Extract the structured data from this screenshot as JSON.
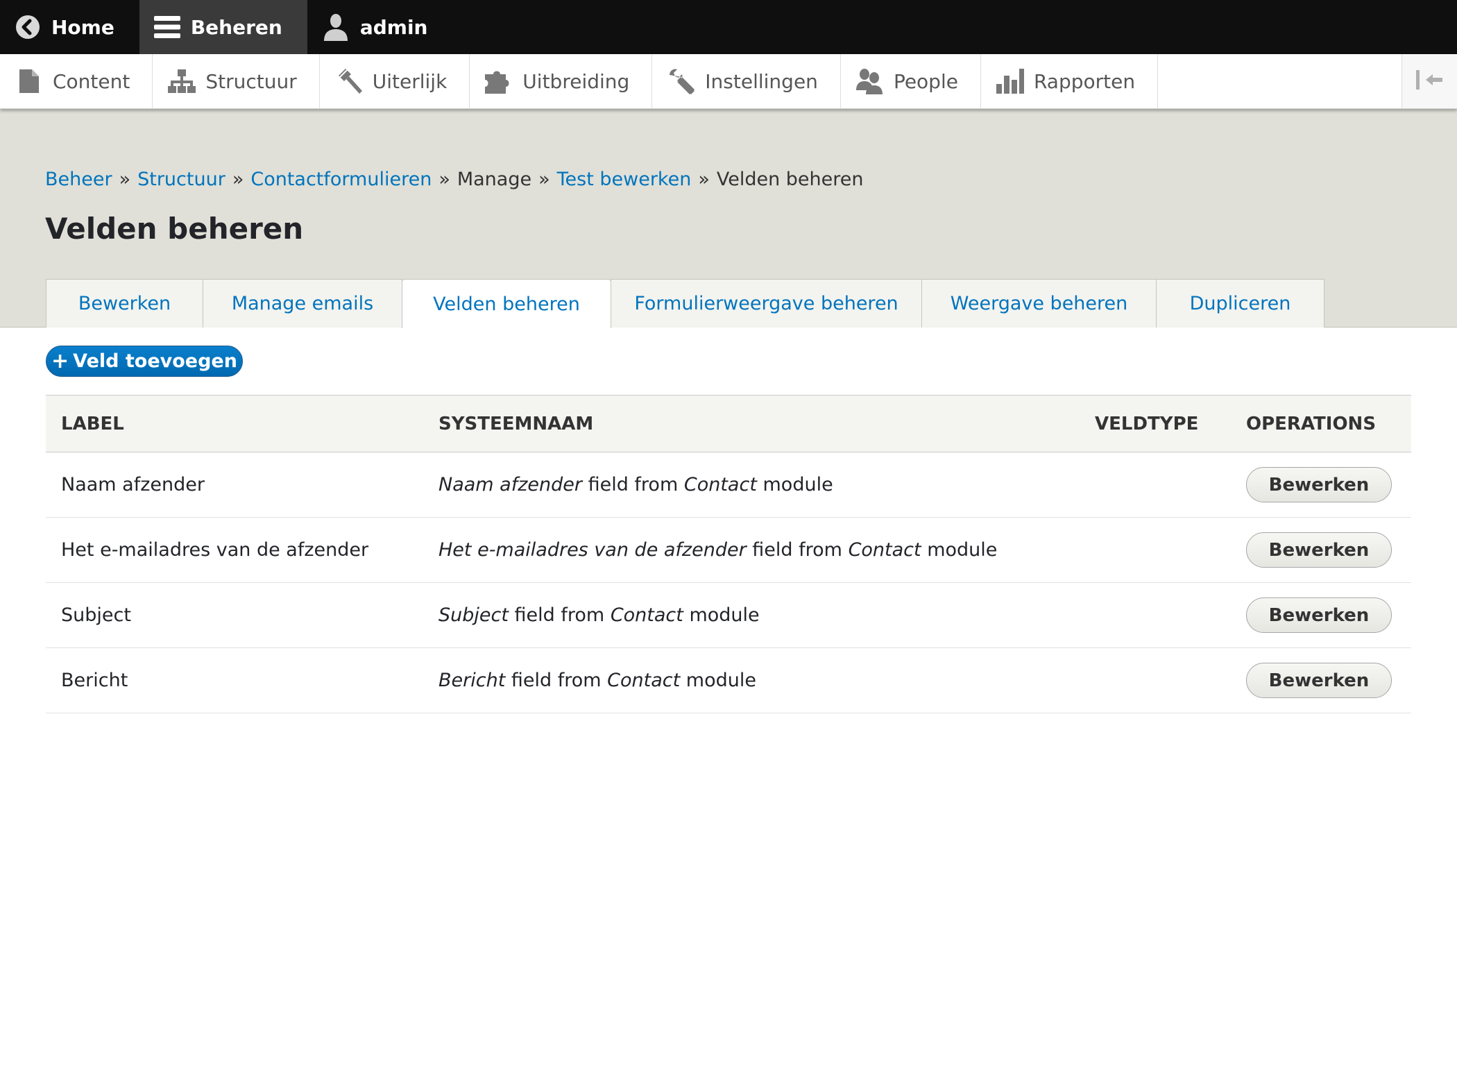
{
  "toolbar": {
    "home": {
      "label": "Home",
      "icon": "back-arrow-icon"
    },
    "manage": {
      "label": "Beheren",
      "icon": "hamburger-menu-icon"
    },
    "user": {
      "label": "admin",
      "icon": "user-icon"
    }
  },
  "tray": {
    "items": [
      {
        "label": "Content",
        "icon": "file-icon"
      },
      {
        "label": "Structuur",
        "icon": "sitemap-icon"
      },
      {
        "label": "Uiterlijk",
        "icon": "paintbrush-icon"
      },
      {
        "label": "Uitbreiding",
        "icon": "puzzle-icon"
      },
      {
        "label": "Instellingen",
        "icon": "wrench-icon"
      },
      {
        "label": "People",
        "icon": "people-icon"
      },
      {
        "label": "Rapporten",
        "icon": "bar-chart-icon"
      }
    ],
    "toggle_icon": "collapse-tray-icon"
  },
  "breadcrumb": {
    "items": [
      {
        "label": "Beheer",
        "link": true
      },
      {
        "label": "Structuur",
        "link": true
      },
      {
        "label": "Contactformulieren",
        "link": true
      },
      {
        "label": "Manage",
        "link": false
      },
      {
        "label": "Test bewerken",
        "link": true
      },
      {
        "label": "Velden beheren",
        "link": false
      }
    ],
    "separator": "»"
  },
  "page": {
    "title": "Velden beheren"
  },
  "tabs": [
    {
      "label": "Bewerken",
      "active": false
    },
    {
      "label": "Manage emails",
      "active": false
    },
    {
      "label": "Velden beheren",
      "active": true
    },
    {
      "label": "Formulierweergave beheren",
      "active": false
    },
    {
      "label": "Weergave beheren",
      "active": false
    },
    {
      "label": "Dupliceren",
      "active": false
    }
  ],
  "actions": {
    "add_field_plus": "+",
    "add_field_label": "Veld toevoegen"
  },
  "table": {
    "headers": {
      "label": "LABEL",
      "system_name": "SYSTEEMNAAM",
      "field_type": "VELDTYPE",
      "operations": "OPERATIONS"
    },
    "field_from_text": "field from",
    "module_text": "module",
    "rows": [
      {
        "label": "Naam afzender",
        "sys_field": "Naam afzender",
        "sys_module": "Contact",
        "field_type": "",
        "edit_label": "Bewerken"
      },
      {
        "label": "Het e-mailadres van de afzender",
        "sys_field": "Het e-mailadres van de afzender",
        "sys_module": "Contact",
        "field_type": "",
        "edit_label": "Bewerken"
      },
      {
        "label": "Subject",
        "sys_field": "Subject",
        "sys_module": "Contact",
        "field_type": "",
        "edit_label": "Bewerken"
      },
      {
        "label": "Bericht",
        "sys_field": "Bericht",
        "sys_module": "Contact",
        "field_type": "",
        "edit_label": "Bewerken"
      }
    ]
  },
  "colors": {
    "link": "#0074bd",
    "toolbar_bg": "#0f0f0f",
    "header_bg": "#e0e0d8",
    "primary_button": "#0074bd"
  }
}
